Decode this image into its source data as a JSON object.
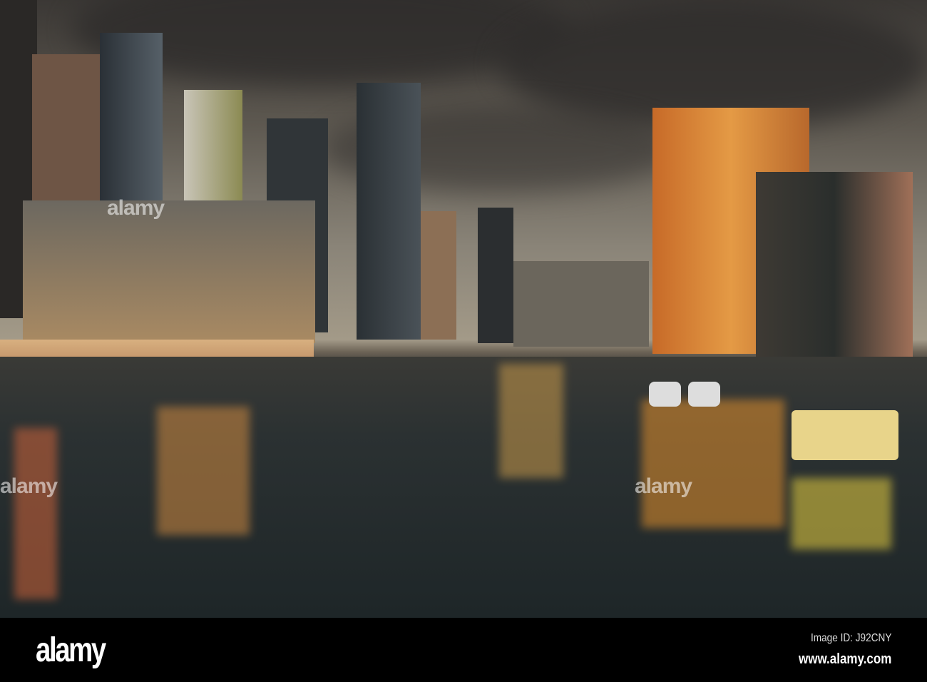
{
  "watermark": {
    "logo": "alamy",
    "image_id": "Image ID: J92CNY",
    "site": "www.alamy.com"
  },
  "colors": {
    "sky": "#8a8478",
    "water": "#1f2526",
    "lights": "#f2a23a"
  }
}
